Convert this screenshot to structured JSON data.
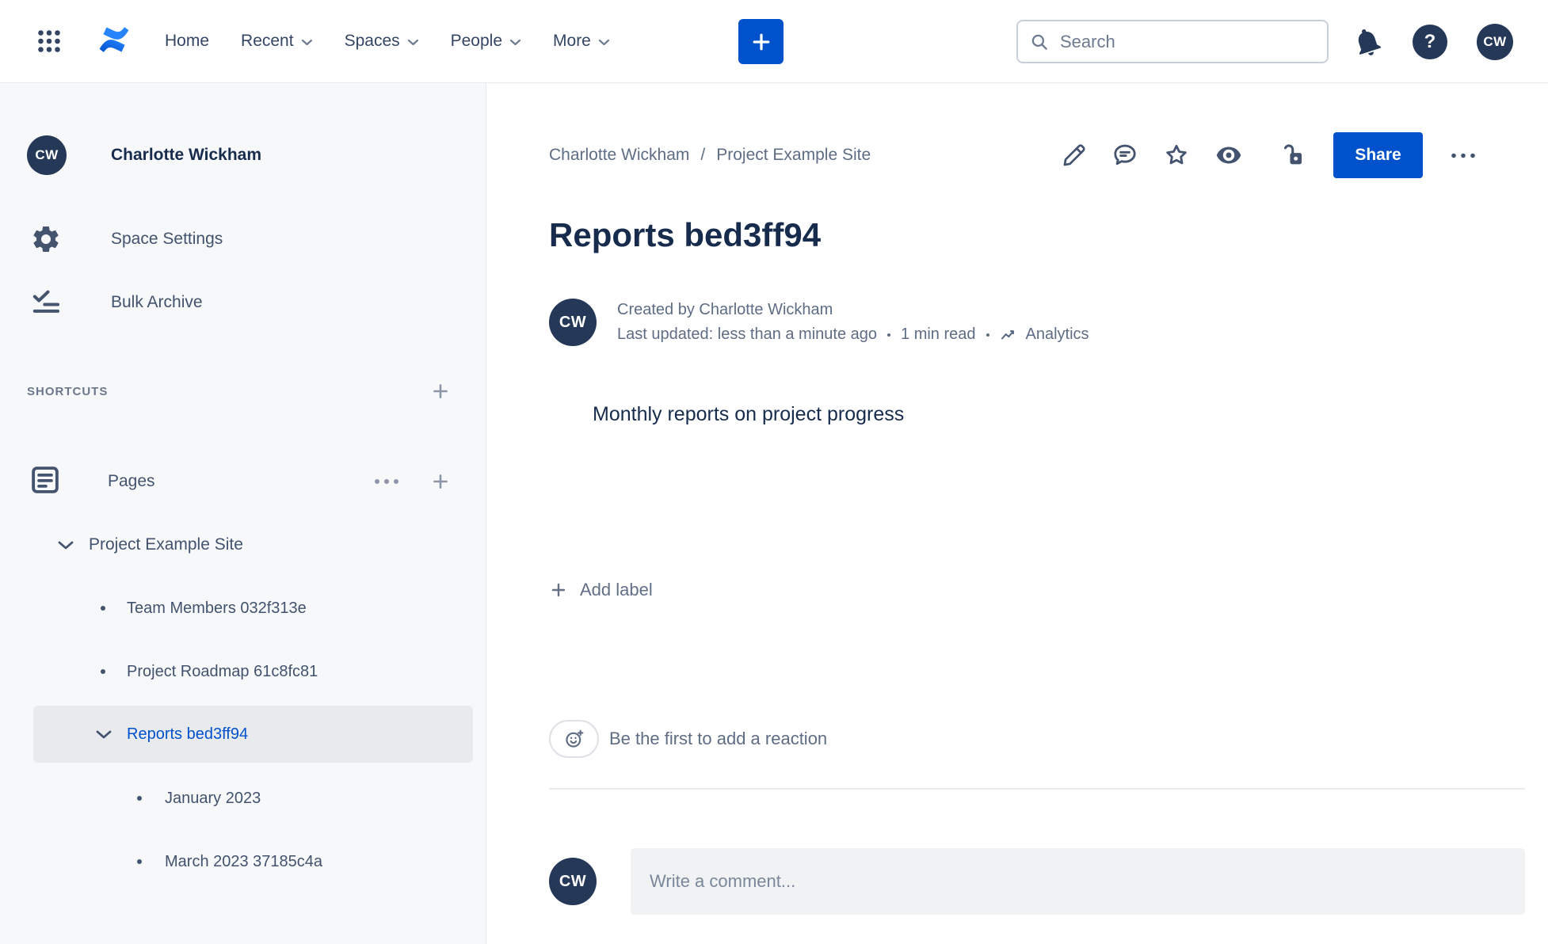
{
  "topnav": {
    "menu": [
      {
        "label": "Home",
        "has_dropdown": false
      },
      {
        "label": "Recent",
        "has_dropdown": true
      },
      {
        "label": "Spaces",
        "has_dropdown": true
      },
      {
        "label": "People",
        "has_dropdown": true
      },
      {
        "label": "More",
        "has_dropdown": true
      }
    ],
    "search": {
      "placeholder": "Search",
      "value": ""
    },
    "help_glyph": "?",
    "avatar_initials": "CW"
  },
  "sidebar": {
    "avatar_initials": "CW",
    "space_name": "Charlotte Wickham",
    "menu": [
      {
        "label": "Space Settings",
        "icon": "gear-icon"
      },
      {
        "label": "Bulk Archive",
        "icon": "bulk-archive-icon"
      }
    ],
    "shortcuts_heading": "SHORTCUTS",
    "pages_label": "Pages",
    "tree": {
      "root": {
        "label": "Project Example Site",
        "expanded": true
      },
      "children": [
        {
          "label": "Team Members 032f313e",
          "selected": false
        },
        {
          "label": "Project Roadmap 61c8fc81",
          "selected": false
        },
        {
          "label": "Reports bed3ff94",
          "selected": true,
          "expanded": true
        }
      ],
      "reports_children": [
        {
          "label": "January 2023"
        },
        {
          "label": "March 2023 37185c4a"
        }
      ]
    }
  },
  "content": {
    "breadcrumb": [
      {
        "label": "Charlotte Wickham"
      },
      {
        "label": "Project Example Site"
      }
    ],
    "breadcrumb_separator": "/",
    "share_label": "Share",
    "page_title": "Reports bed3ff94",
    "byline": {
      "avatar_initials": "CW",
      "created": "Created by Charlotte Wickham",
      "last_updated": "Last updated: less than a minute ago",
      "read_time": "1 min read",
      "analytics_label": "Analytics"
    },
    "body_text": "Monthly reports on project progress",
    "add_label_text": "Add label",
    "reaction_prompt": "Be the first to add a reaction",
    "comment": {
      "avatar_initials": "CW",
      "placeholder": "Write a comment..."
    }
  },
  "colors": {
    "brand_blue": "#0052CC",
    "navy_text": "#172B4D",
    "gray_text": "#5E6C84",
    "avatar_navy": "#253858",
    "sidebar_bg": "#F7F8F9",
    "selected_bg": "#E9EAED",
    "logo_blue": "#2684FF"
  },
  "icons": {
    "app-switcher-icon": "3x3-dot-grid",
    "confluence-logo": "double-swoosh",
    "chevron-down-icon": "⌄",
    "plus-icon": "+",
    "search-icon": "magnifier",
    "bell-icon": "filled-bell",
    "help-icon": "question-mark-circle",
    "gear-icon": "cogwheel",
    "bulk-archive-icon": "check-with-lines",
    "pages-icon": "document-lines",
    "bullet-icon": "•",
    "ellipsis-icon": "•••",
    "edit-pencil-icon": "pencil-outline",
    "comment-bubble-icon": "speech-bubble-lines",
    "star-icon": "star-outline",
    "watch-eye-icon": "filled-eye",
    "unlock-icon": "open-padlock",
    "analytics-icon": "line-chart-arrow",
    "add-reaction-icon": "smiley-plus"
  }
}
